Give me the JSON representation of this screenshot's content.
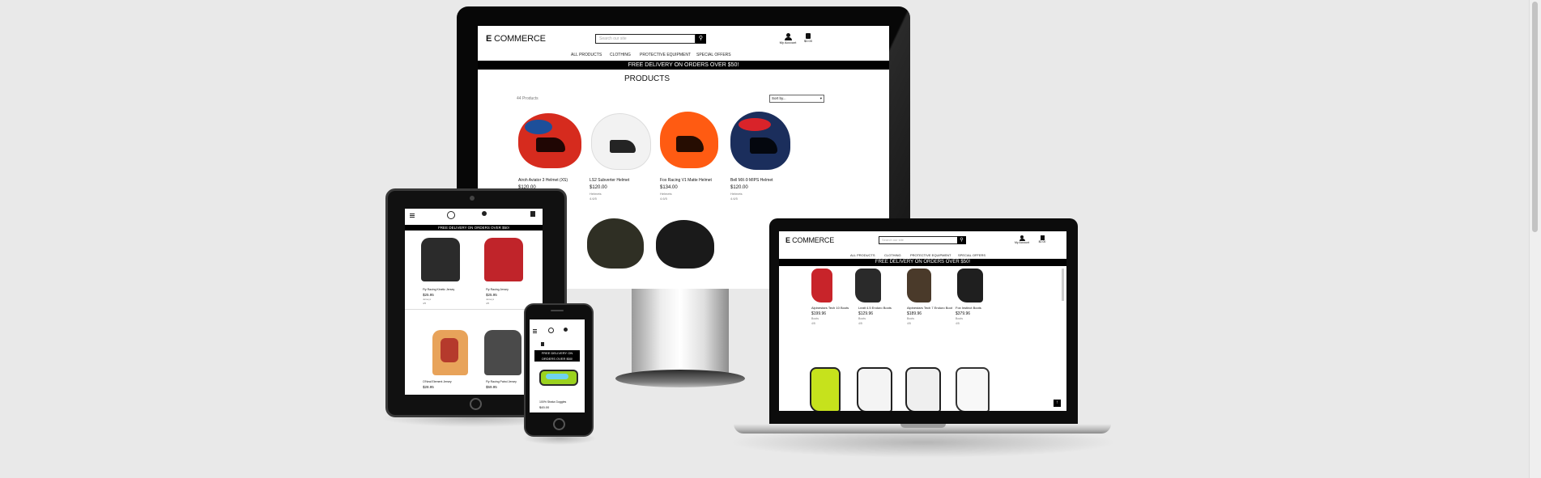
{
  "brand": {
    "bold": "E",
    "rest": " COMMERCE"
  },
  "search": {
    "placeholder": "Search our site",
    "icon": "search-icon"
  },
  "account": {
    "my_account": "My Account",
    "bag_total": "$0.00"
  },
  "nav": [
    "ALL PRODUCTS",
    "CLOTHING",
    "PROTECTIVE EQUIPMENT",
    "SPECIAL OFFERS"
  ],
  "banner": {
    "text": "FREE DELIVERY ON ORDERS OVER $50!"
  },
  "monitor": {
    "page_title": "PRODUCTS",
    "count_label": "44 Products",
    "sort_label": "Sort by...",
    "products": [
      {
        "name": "Airoh Aviator 3 Helmet (XS)",
        "price": "$120.00",
        "category": "Helmets",
        "rating": "4.6/5",
        "color": "#d62b1e"
      },
      {
        "name": "LS2 Subverter Helmet",
        "price": "$120.00",
        "category": "Helmets",
        "rating": "4.6/5",
        "color": "#f2f2f2"
      },
      {
        "name": "Fox Racing V1 Matte Helmet",
        "price": "$134.00",
        "category": "Helmets",
        "rating": "4.6/5",
        "color": "#ff5b12"
      },
      {
        "name": "Bell MX-9 MIPS Helmet",
        "price": "$120.00",
        "category": "Helmets",
        "rating": "4.6/5",
        "color": "#1b2e5c"
      }
    ]
  },
  "laptop": {
    "boots_row1": [
      {
        "name": "Alpinestars Tech 10 Boots",
        "price": "$199.96",
        "category": "Boots",
        "rating": "4/5"
      },
      {
        "name": "Leatt 4.5 Enduro Boots",
        "price": "$129.96",
        "category": "Boots",
        "rating": "4/5"
      },
      {
        "name": "Alpinestars Tech 7 Enduro Boots",
        "price": "$189.96",
        "category": "Boots",
        "rating": "4/5"
      },
      {
        "name": "Fox Instinct Boots",
        "price": "$379.96",
        "category": "Boots",
        "rating": "4/5"
      }
    ]
  },
  "tablet": {
    "products": [
      {
        "name": "Fly Racing Kinetic Jersey",
        "price": "$25.95",
        "category": "Jerseys",
        "rating": "4/5"
      },
      {
        "name": "Fly Racing Jersey",
        "price": "$25.95",
        "category": "Jerseys",
        "rating": "4/5"
      },
      {
        "name": "O'Neal Element Jersey",
        "price": "$28.95",
        "category": "Jerseys",
        "rating": "4/5"
      },
      {
        "name": "Fly Racing Patrol Jersey",
        "price": "$59.95",
        "category": "Jerseys",
        "rating": "4/5"
      }
    ]
  },
  "phone": {
    "banner_lines": [
      "FREE DELIVERY ON",
      "ORDERS OVER $50!"
    ],
    "product": {
      "name": "100% Strata Goggles",
      "price": "$45.00"
    }
  },
  "colors": {
    "page_bg": "#e9e9e9",
    "device_bezel": "#070707",
    "banner_bg": "#000000",
    "accent": "#000000"
  }
}
